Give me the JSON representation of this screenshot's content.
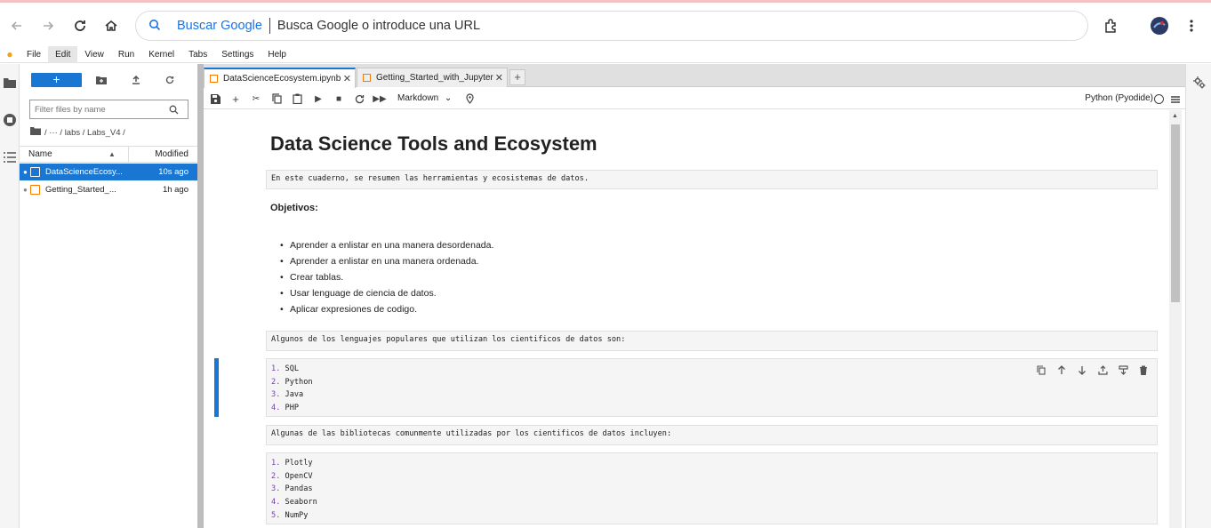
{
  "browser": {
    "search_engine": "Buscar Google",
    "omnibox_hint": "Busca Google o introduce una URL"
  },
  "menubar": {
    "items": [
      "File",
      "Edit",
      "View",
      "Run",
      "Kernel",
      "Tabs",
      "Settings",
      "Help"
    ]
  },
  "filebrowser": {
    "new_label": "+",
    "filter_placeholder": "Filter files by name",
    "crumbs": "/ ··· / labs / Labs_V4 /",
    "col_name": "Name",
    "col_modified": "Modified",
    "files": [
      {
        "name": "DataScienceEcosy...",
        "modified": "10s ago",
        "selected": true
      },
      {
        "name": "Getting_Started_...",
        "modified": "1h ago",
        "selected": false
      }
    ]
  },
  "tabs": [
    {
      "label": "DataScienceEcosystem.ipynb",
      "active": true
    },
    {
      "label": "Getting_Started_with_Jupyter",
      "active": false
    }
  ],
  "toolbar": {
    "cell_type": "Markdown",
    "kernel": "Python (Pyodide)"
  },
  "notebook": {
    "title": "Data Science Tools and Ecosystem",
    "intro": "En este cuaderno, se resumen las herramientas y ecosistemas de datos.",
    "objectives_heading": "Objetivos:",
    "objectives": [
      "Aprender a enlistar en una manera desordenada.",
      "Aprender a enlistar en una manera ordenada.",
      "Crear tablas.",
      "Usar lenguage de ciencia de datos.",
      "Aplicar expresiones de codigo."
    ],
    "languages_intro": "Algunos de los lenguajes populares que utilizan los cientificos de datos son:",
    "languages": [
      "SQL",
      "Python",
      "Java",
      "PHP"
    ],
    "libraries_intro": "Algunas de las bibliotecas comunmente utilizadas por los cientificos de datos incluyen:",
    "libraries": [
      "Plotly",
      "OpenCV",
      "Pandas",
      "Seaborn",
      "NumPy"
    ]
  }
}
